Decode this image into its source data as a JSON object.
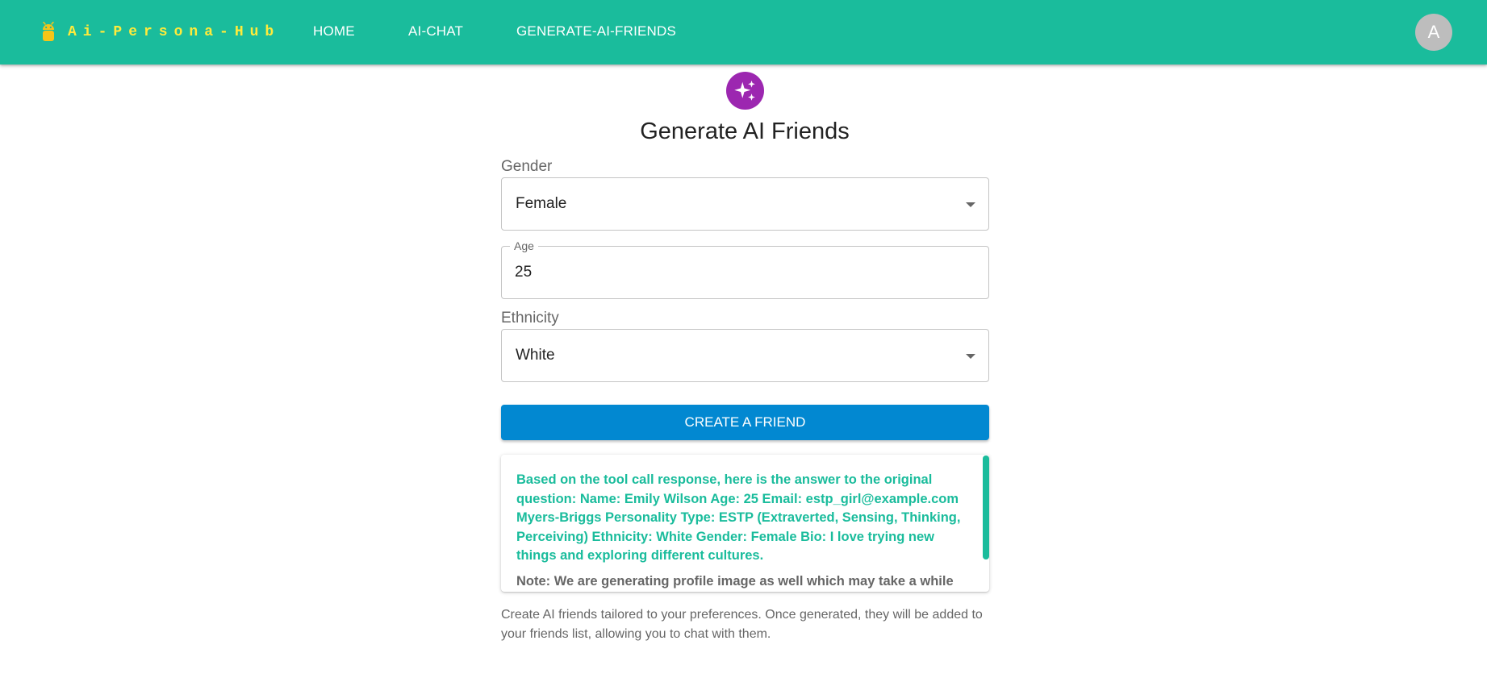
{
  "appbar": {
    "brand": "Ai-Persona-Hub",
    "brand_icon": "android-icon",
    "nav": [
      {
        "label": "HOME"
      },
      {
        "label": "AI-CHAT"
      },
      {
        "label": "GENERATE-AI-FRIENDS"
      }
    ],
    "avatar_initial": "A"
  },
  "page": {
    "title": "Generate AI Friends",
    "hero_icon": "sparkles-icon"
  },
  "form": {
    "gender": {
      "label": "Gender",
      "value": "Female"
    },
    "age": {
      "label": "Age",
      "value": "25"
    },
    "ethnicity": {
      "label": "Ethnicity",
      "value": "White"
    },
    "submit_label": "CREATE A FRIEND"
  },
  "response": {
    "text": "Based on the tool call response, here is the answer to the original question: Name: Emily Wilson Age: 25 Email: estp_girl@example.com Myers-Briggs Personality Type: ESTP (Extraverted, Sensing, Thinking, Perceiving) Ethnicity: White Gender: Female Bio: I love trying new things and exploring different cultures.",
    "note": "Note: We are generating profile image as well which may take a while"
  },
  "description": "Create AI friends tailored to your preferences. Once generated, they will be added to your friends list, allowing you to chat with them.",
  "colors": {
    "appbar": "#1abc9c",
    "brand_text": "#ffeb3b",
    "hero_icon_bg": "#9c27b0",
    "button": "#0288d1",
    "response_text": "#1abc9c",
    "avatar_bg": "#bdbdbd"
  }
}
